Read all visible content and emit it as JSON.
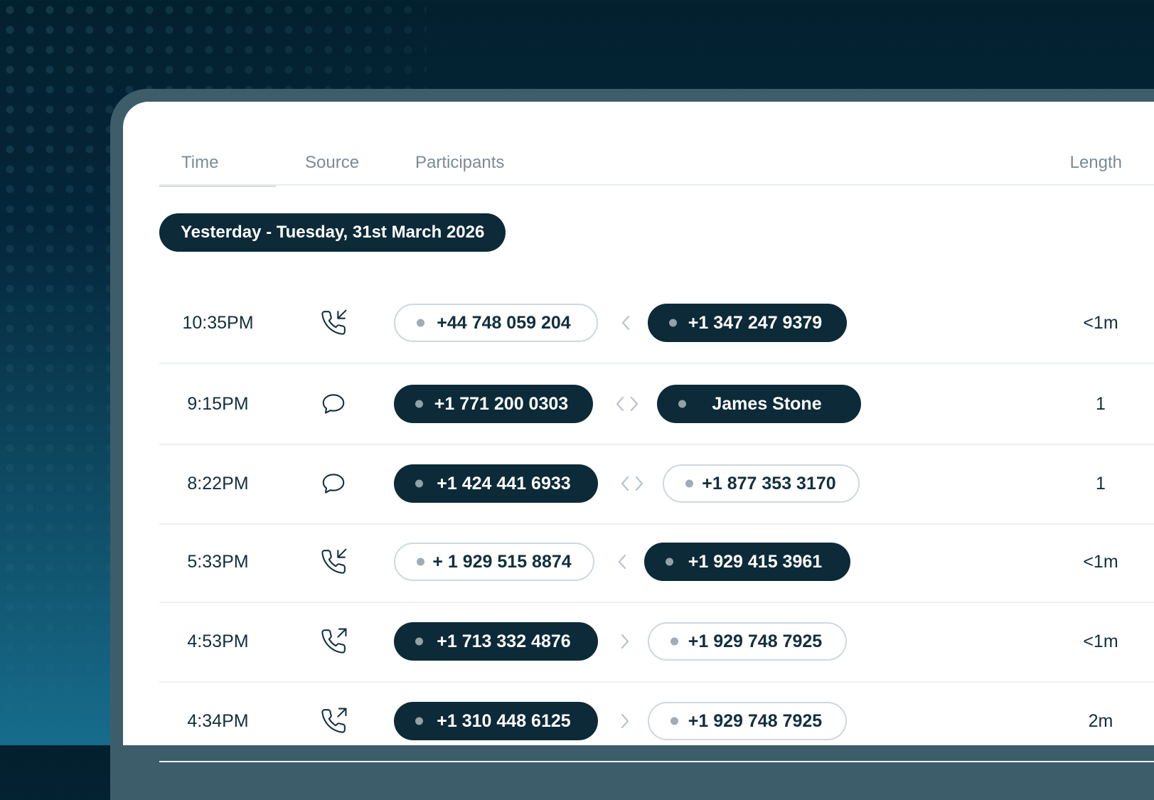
{
  "table": {
    "columns": {
      "time": "Time",
      "source": "Source",
      "participants": "Participants",
      "length": "Length"
    },
    "date_group": "Yesterday - Tuesday, 31st March 2026",
    "rows": [
      {
        "time": "10:35PM",
        "source_icon": "incoming-call-icon",
        "from": {
          "label": "+44 748 059 204",
          "style": "outlined"
        },
        "direction": "left",
        "to": {
          "label": "+1 347 247 9379",
          "style": "filled"
        },
        "length": "<1m"
      },
      {
        "time": "9:15PM",
        "source_icon": "message-icon",
        "from": {
          "label": "+1 771 200 0303",
          "style": "filled"
        },
        "direction": "both",
        "to": {
          "label": "James Stone",
          "style": "filled"
        },
        "length": "1"
      },
      {
        "time": "8:22PM",
        "source_icon": "message-icon",
        "from": {
          "label": "+1 424 441 6933",
          "style": "filled"
        },
        "direction": "both",
        "to": {
          "label": "+1 877 353 3170",
          "style": "outlined"
        },
        "length": "1"
      },
      {
        "time": "5:33PM",
        "source_icon": "incoming-call-icon",
        "from": {
          "label": "+ 1 929 515 8874",
          "style": "outlined"
        },
        "direction": "left",
        "to": {
          "label": "+1 929 415 3961",
          "style": "filled"
        },
        "length": "<1m"
      },
      {
        "time": "4:53PM",
        "source_icon": "outgoing-call-icon",
        "from": {
          "label": "+1 713 332 4876",
          "style": "filled"
        },
        "direction": "right",
        "to": {
          "label": "+1 929 748 7925",
          "style": "outlined"
        },
        "length": "<1m"
      },
      {
        "time": "4:34PM",
        "source_icon": "outgoing-call-icon",
        "from": {
          "label": "+1 310 448 6125",
          "style": "filled"
        },
        "direction": "right",
        "to": {
          "label": "+1 929 748 7925",
          "style": "outlined"
        },
        "length": "2m"
      }
    ]
  },
  "colors": {
    "brand_dark": "#0c2a38",
    "text": "#12303d",
    "muted": "#7b8b95",
    "arrow": "#b9c4ca"
  }
}
